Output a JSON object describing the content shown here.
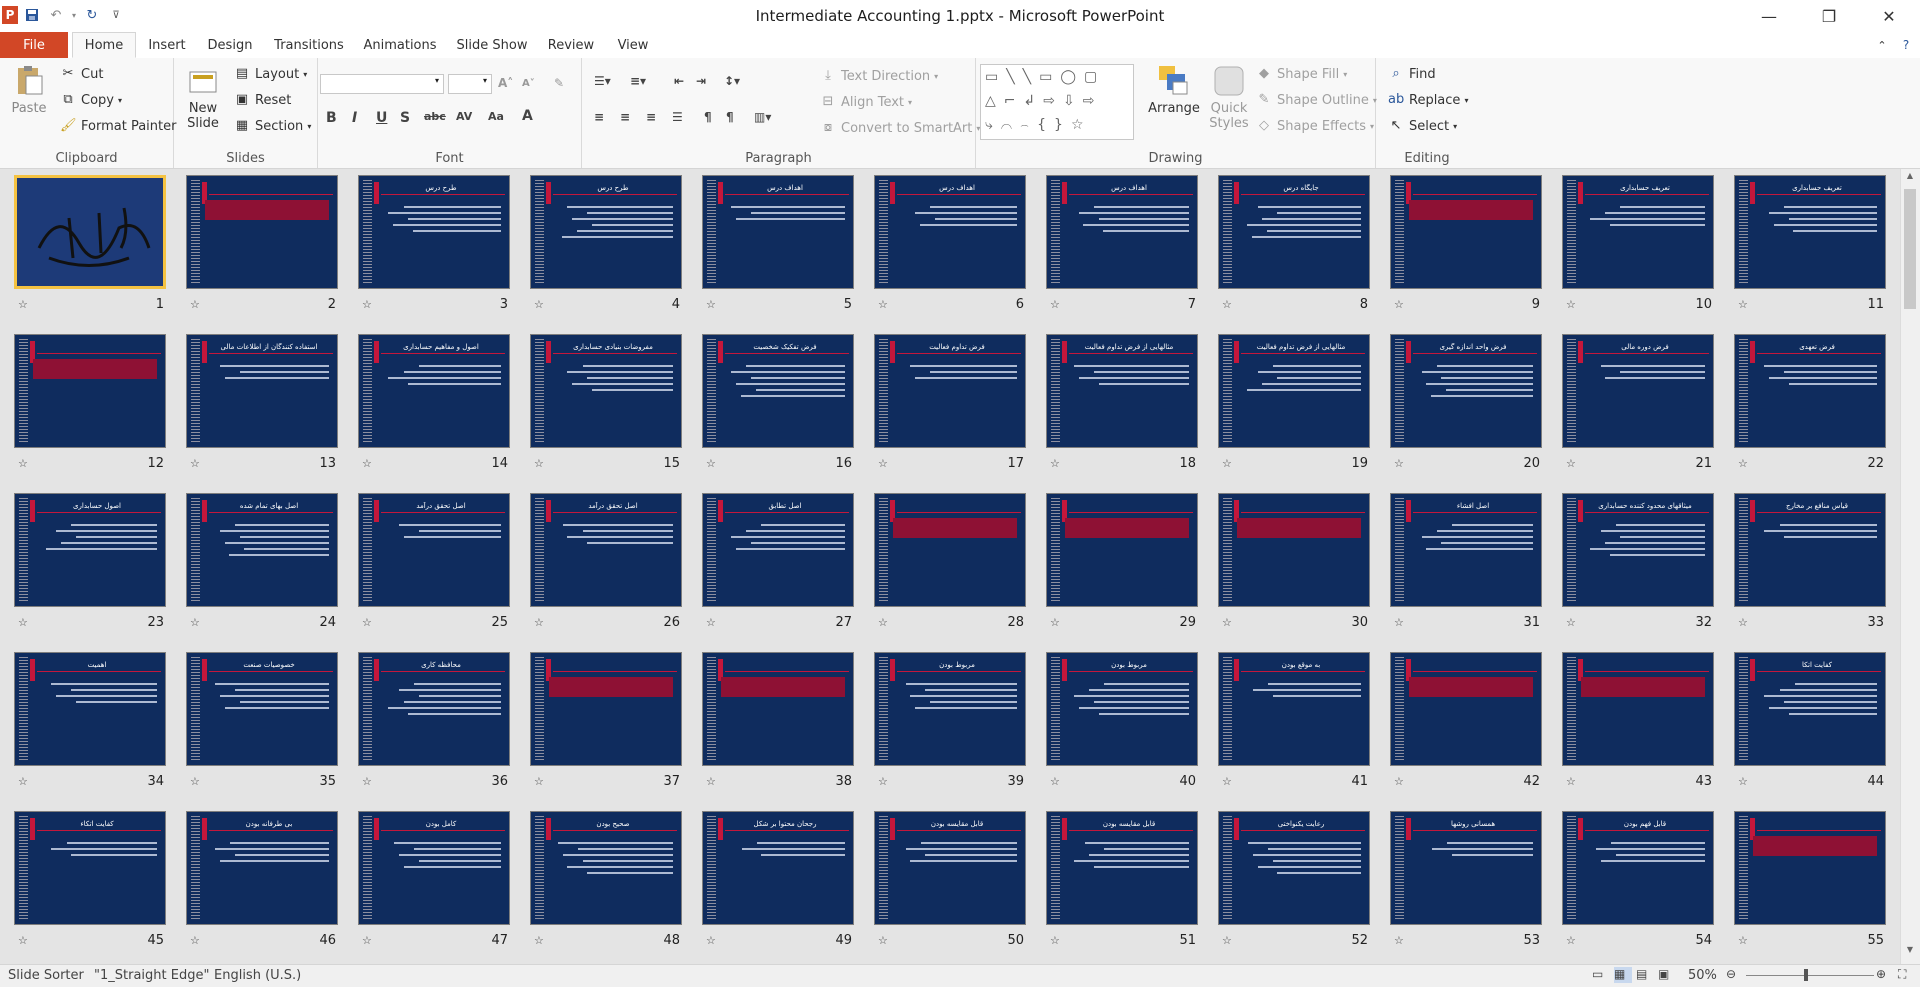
{
  "window": {
    "title": "Intermediate Accounting 1.pptx - Microsoft PowerPoint"
  },
  "quick_access": {
    "icons": [
      "powerpoint-logo",
      "save-icon",
      "undo-icon",
      "redo-icon",
      "customize-icon"
    ]
  },
  "tabs": [
    "File",
    "Home",
    "Insert",
    "Design",
    "Transitions",
    "Animations",
    "Slide Show",
    "Review",
    "View"
  ],
  "ribbon": {
    "clipboard": {
      "label": "Clipboard",
      "paste": "Paste",
      "cut": "Cut",
      "copy": "Copy",
      "format_painter": "Format Painter"
    },
    "slides": {
      "label": "Slides",
      "new_slide_1": "New",
      "new_slide_2": "Slide",
      "layout": "Layout",
      "reset": "Reset",
      "section": "Section"
    },
    "font": {
      "label": "Font",
      "font_name": "",
      "font_size": ""
    },
    "paragraph": {
      "label": "Paragraph",
      "text_direction": "Text Direction",
      "align_text": "Align Text",
      "convert_smartart": "Convert to SmartArt"
    },
    "drawing": {
      "label": "Drawing",
      "arrange": "Arrange",
      "quick_styles_1": "Quick",
      "quick_styles_2": "Styles",
      "shape_fill": "Shape Fill",
      "shape_outline": "Shape Outline",
      "shape_effects": "Shape Effects"
    },
    "editing": {
      "label": "Editing",
      "find": "Find",
      "replace": "Replace",
      "select": "Select"
    }
  },
  "slides": [
    {
      "n": "1",
      "t": ""
    },
    {
      "n": "2",
      "t": ""
    },
    {
      "n": "3",
      "t": "طرح درس"
    },
    {
      "n": "4",
      "t": "طرح درس"
    },
    {
      "n": "5",
      "t": "اهداف درس"
    },
    {
      "n": "6",
      "t": "اهداف درس"
    },
    {
      "n": "7",
      "t": "اهداف درس"
    },
    {
      "n": "8",
      "t": "جایگاه درس"
    },
    {
      "n": "9",
      "t": ""
    },
    {
      "n": "10",
      "t": "تعریف حسابداری"
    },
    {
      "n": "11",
      "t": "تعریف حسابداری"
    },
    {
      "n": "12",
      "t": ""
    },
    {
      "n": "13",
      "t": "استفاده کنندگان از اطلاعات مالی"
    },
    {
      "n": "14",
      "t": "اصول و مفاهیم حسابداری"
    },
    {
      "n": "15",
      "t": "مفروضات بنیادی حسابداری"
    },
    {
      "n": "16",
      "t": "فرض تفکیک شخصیت"
    },
    {
      "n": "17",
      "t": "فرض تداوم فعالیت"
    },
    {
      "n": "18",
      "t": "مثالهایی از فرض تداوم فعالیت"
    },
    {
      "n": "19",
      "t": "مثالهایی از فرض تداوم فعالیت"
    },
    {
      "n": "20",
      "t": "فرض واحد اندازه گیری"
    },
    {
      "n": "21",
      "t": "فرض دوره مالی"
    },
    {
      "n": "22",
      "t": "فرض تعهدی"
    },
    {
      "n": "23",
      "t": "اصول حسابداری"
    },
    {
      "n": "24",
      "t": "اصل بهای تمام شده"
    },
    {
      "n": "25",
      "t": "اصل تحقق درآمد"
    },
    {
      "n": "26",
      "t": "اصل تحقق درآمد"
    },
    {
      "n": "27",
      "t": "اصل تطابق"
    },
    {
      "n": "28",
      "t": ""
    },
    {
      "n": "29",
      "t": ""
    },
    {
      "n": "30",
      "t": ""
    },
    {
      "n": "31",
      "t": "اصل افشاء"
    },
    {
      "n": "32",
      "t": "میثاقهای محدود کننده حسابداری"
    },
    {
      "n": "33",
      "t": "قیاس منافع بر مخارج"
    },
    {
      "n": "34",
      "t": "اهمیت"
    },
    {
      "n": "35",
      "t": "خصوصیات صنعت"
    },
    {
      "n": "36",
      "t": "محافظه کاری"
    },
    {
      "n": "37",
      "t": ""
    },
    {
      "n": "38",
      "t": ""
    },
    {
      "n": "39",
      "t": "مربوط بودن"
    },
    {
      "n": "40",
      "t": "مربوط بودن"
    },
    {
      "n": "41",
      "t": "به موقع بودن"
    },
    {
      "n": "42",
      "t": ""
    },
    {
      "n": "43",
      "t": ""
    },
    {
      "n": "44",
      "t": "کفایت اتکا"
    },
    {
      "n": "45",
      "t": "کفایت اتکاء"
    },
    {
      "n": "46",
      "t": "بی طرفانه بودن"
    },
    {
      "n": "47",
      "t": "کامل بودن"
    },
    {
      "n": "48",
      "t": "صحیح بودن"
    },
    {
      "n": "49",
      "t": "رجحان محتوا بر شکل"
    },
    {
      "n": "50",
      "t": "قابل مقایسه بودن"
    },
    {
      "n": "51",
      "t": "قابل مقایسه بودن"
    },
    {
      "n": "52",
      "t": "رعایت یکنواختی"
    },
    {
      "n": "53",
      "t": "همسانی روشها"
    },
    {
      "n": "54",
      "t": "قابل فهم بودن"
    },
    {
      "n": "55",
      "t": ""
    }
  ],
  "status": {
    "view": "Slide Sorter",
    "theme": "\"1_Straight Edge\"",
    "language": "English (U.S.)",
    "zoom": "50%"
  }
}
